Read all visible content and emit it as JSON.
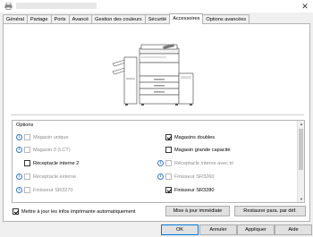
{
  "tabs": [
    "Général",
    "Partage",
    "Ports",
    "Avancé",
    "Gestion des couleurs",
    "Sécurité",
    "Accessoires",
    "Options avancées"
  ],
  "options": {
    "title": "Options",
    "left": [
      {
        "label": "Magasin unique",
        "info": true,
        "checked": false,
        "disabled": true
      },
      {
        "label": "Magasin 3 (LCT)",
        "info": true,
        "checked": false,
        "disabled": true
      },
      {
        "label": "Réceptacle interne 2",
        "info": false,
        "checked": false,
        "disabled": false
      },
      {
        "label": "Réceptacle externe",
        "info": true,
        "checked": false,
        "disabled": true
      },
      {
        "label": "Finisseur SR3270",
        "info": true,
        "checked": false,
        "disabled": true
      }
    ],
    "right": [
      {
        "label": "Magasins doubles",
        "info": false,
        "checked": true,
        "disabled": false
      },
      {
        "label": "Magasin grande capacité",
        "info": false,
        "checked": false,
        "disabled": false
      },
      {
        "label": "Réceptacle interne avec tri",
        "info": true,
        "checked": false,
        "disabled": true
      },
      {
        "label": "Finisseur SR3260",
        "info": true,
        "checked": false,
        "disabled": true
      },
      {
        "label": "Finisseur SR3280",
        "info": false,
        "checked": true,
        "disabled": false
      }
    ]
  },
  "auto_update": {
    "label": "Mettre à jour les infos imprimante automatiquement",
    "checked": true
  },
  "buttons": {
    "update_now": "Mise à jour immédiate",
    "restore_default": "Restaurer para. par déf.",
    "ok": "OK",
    "cancel": "Annuler",
    "apply": "Appliquer",
    "help": "Aide"
  },
  "icons": {
    "close": "close-icon",
    "info": "info-icon",
    "printer": "printer-icon"
  }
}
